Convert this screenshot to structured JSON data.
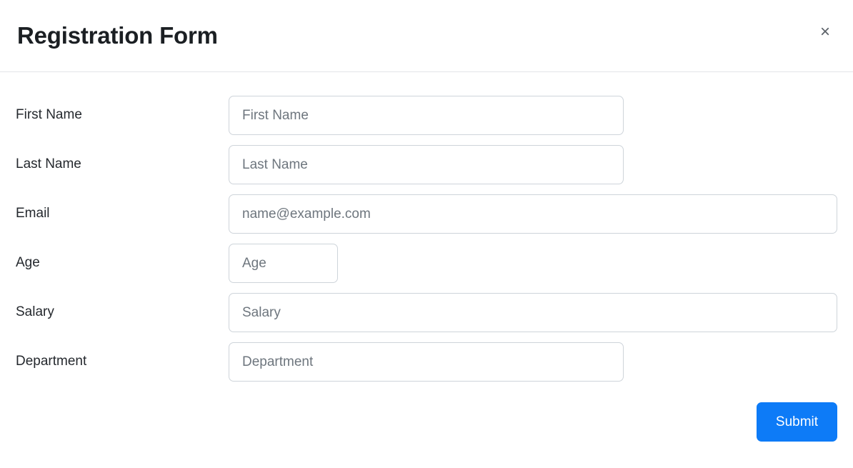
{
  "dialog": {
    "title": "Registration Form",
    "close_icon": "close-icon",
    "close_glyph": "×",
    "accent_color": "#0d7bf7",
    "border_color": "#ced4da",
    "placeholder_color": "#6e767e",
    "background_color": "#ffffff"
  },
  "form": {
    "fields": [
      {
        "name": "first-name",
        "label": "First Name",
        "placeholder": "First Name",
        "value": "",
        "type": "text",
        "width": "w-medium"
      },
      {
        "name": "last-name",
        "label": "Last Name",
        "placeholder": "Last Name",
        "value": "",
        "type": "text",
        "width": "w-medium"
      },
      {
        "name": "email",
        "label": "Email",
        "placeholder": "name@example.com",
        "value": "",
        "type": "email",
        "width": "w-wide"
      },
      {
        "name": "age",
        "label": "Age",
        "placeholder": "Age",
        "value": "",
        "type": "number",
        "width": "w-narrow"
      },
      {
        "name": "salary",
        "label": "Salary",
        "placeholder": "Salary",
        "value": "",
        "type": "number",
        "width": "w-wide"
      },
      {
        "name": "department",
        "label": "Department",
        "placeholder": "Department",
        "value": "",
        "type": "text",
        "width": "w-medium"
      }
    ]
  },
  "footer": {
    "submit_label": "Submit"
  }
}
